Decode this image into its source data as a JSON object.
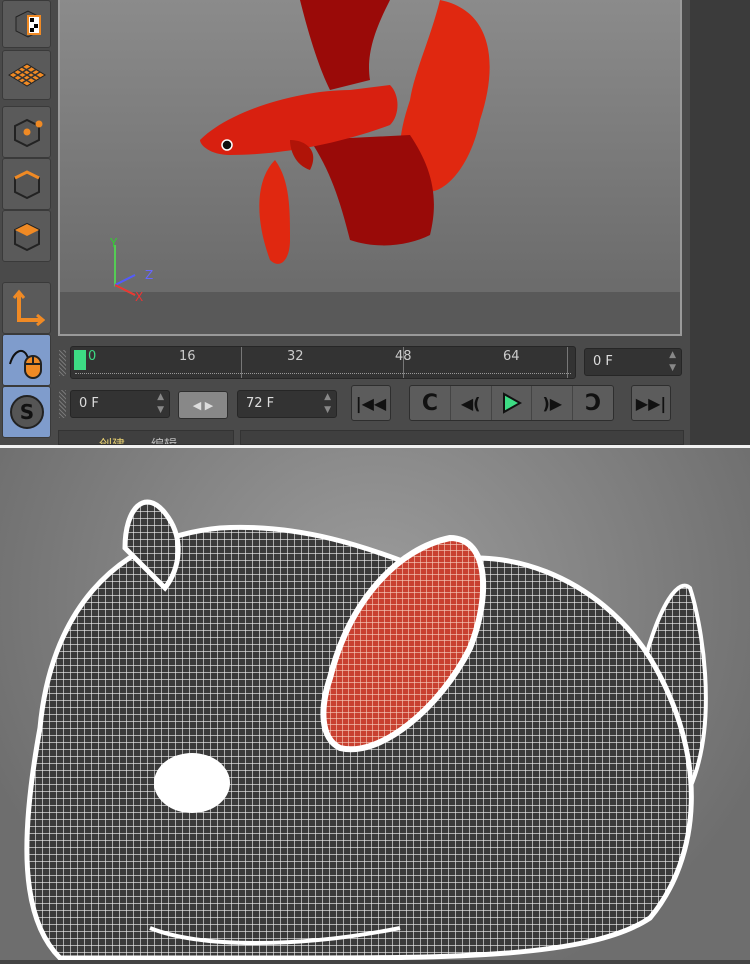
{
  "toolbar": {
    "items": [
      {
        "name": "texture-mode"
      },
      {
        "name": "workplane"
      },
      {
        "name": "points-mode"
      },
      {
        "name": "edges-mode"
      },
      {
        "name": "polygons-mode"
      },
      {
        "name": "axis-mode"
      },
      {
        "name": "tweak-mode",
        "active": true
      },
      {
        "name": "snap",
        "active": true
      }
    ]
  },
  "viewport": {
    "axis": {
      "y": "Y",
      "z": "Z",
      "x": "X"
    }
  },
  "timeline": {
    "ticks": [
      "0",
      "16",
      "32",
      "48",
      "64"
    ],
    "current_frame": "0 F"
  },
  "transport": {
    "start_frame": "0 F",
    "end_frame": "72 F"
  },
  "bottom_tabs": {
    "create": "创建",
    "edit": "编辑"
  },
  "colors": {
    "accent": "#3ddc84",
    "orange": "#f08a24",
    "fish": "#d42010"
  }
}
